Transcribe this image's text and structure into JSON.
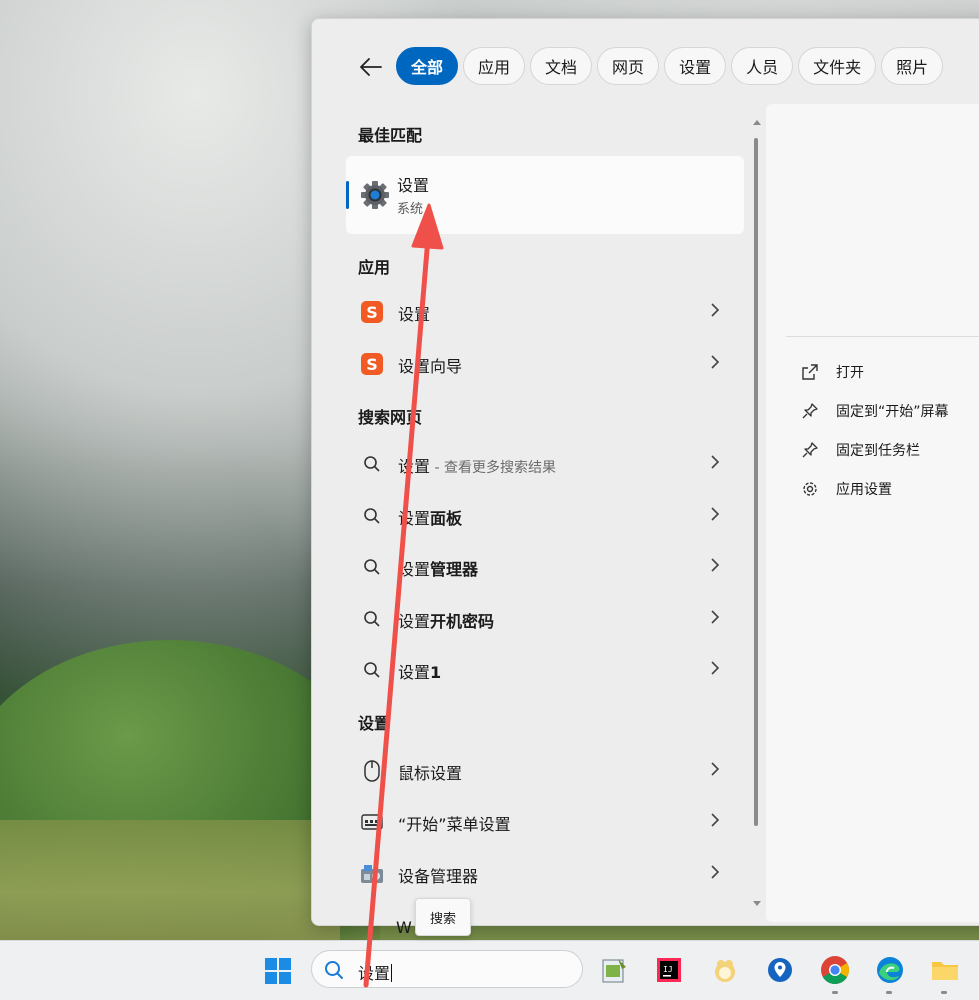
{
  "filters": [
    {
      "label": "全部",
      "active": true
    },
    {
      "label": "应用"
    },
    {
      "label": "文档"
    },
    {
      "label": "网页"
    },
    {
      "label": "设置"
    },
    {
      "label": "人员"
    },
    {
      "label": "文件夹"
    },
    {
      "label": "照片"
    }
  ],
  "sections": {
    "best": "最佳匹配",
    "apps": "应用",
    "web": "搜索网页",
    "settings": "设置"
  },
  "best_match": {
    "title": "设置",
    "subtitle": "系统"
  },
  "apps": [
    {
      "label": "设置"
    },
    {
      "label": "设置向导"
    }
  ],
  "web": [
    {
      "prefix": "设置",
      "suffix": " - 查看更多搜索结果"
    },
    {
      "prefix": "设置",
      "bold": "面板"
    },
    {
      "prefix": "设置",
      "bold": "管理器"
    },
    {
      "prefix": "设置",
      "bold": "开机密码"
    },
    {
      "prefix": "设置",
      "bold": "1"
    }
  ],
  "settings_items": [
    {
      "label": "鼠标设置"
    },
    {
      "label": "“开始”菜单设置"
    },
    {
      "label": "设备管理器"
    }
  ],
  "partial_item": "W        置",
  "detail_actions": [
    {
      "label": "打开"
    },
    {
      "label": "固定到“开始”屏幕"
    },
    {
      "label": "固定到任务栏"
    },
    {
      "label": "应用设置"
    }
  ],
  "tooltip": "搜索",
  "search": {
    "value": "设置"
  },
  "colors": {
    "accent": "#0067c0",
    "arrow": "#f0504a"
  }
}
